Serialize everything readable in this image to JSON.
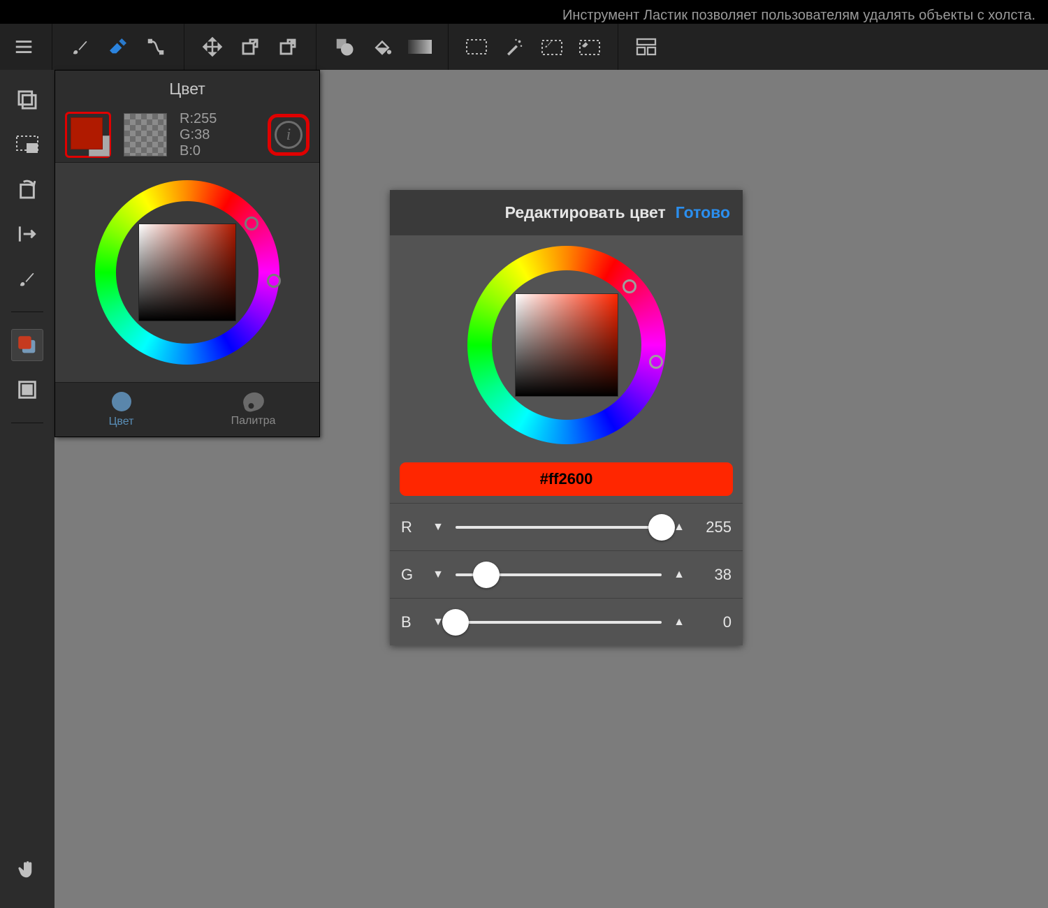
{
  "hint": "Инструмент Ластик позволяет пользователям удалять объекты с холста.",
  "color_panel": {
    "title": "Цвет",
    "rgb": {
      "r": "R:255",
      "g": "G:38",
      "b": "B:0"
    },
    "footer": {
      "color": "Цвет",
      "palette": "Палитра"
    },
    "fg_color": "#b01a00"
  },
  "edit_panel": {
    "title": "Редактировать цвет",
    "done": "Готово",
    "hex": "#ff2600",
    "sliders": {
      "r": {
        "label": "R",
        "value": "255",
        "pct": 100
      },
      "g": {
        "label": "G",
        "value": "38",
        "pct": 15
      },
      "b": {
        "label": "B",
        "value": "0",
        "pct": 0
      }
    }
  }
}
